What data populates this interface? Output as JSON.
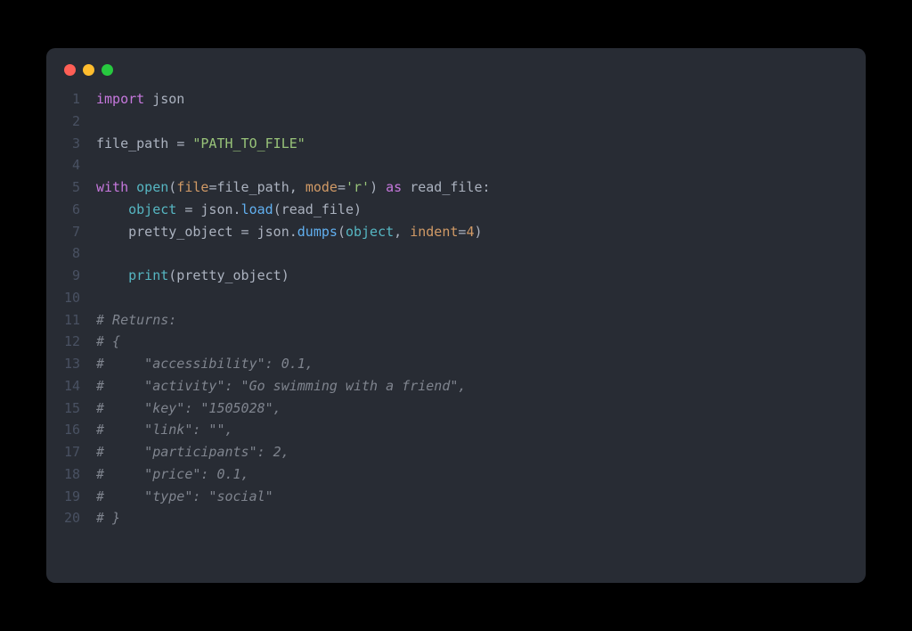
{
  "colors": {
    "background": "#282c34",
    "gutter": "#495162",
    "default": "#abb2bf",
    "keyword": "#c678dd",
    "builtin": "#56b6c2",
    "string": "#98c379",
    "func": "#61afef",
    "param": "#d19a66",
    "number": "#d19a66",
    "comment": "#7f848e",
    "red_dot": "#ff5f56",
    "yellow_dot": "#ffbd2e",
    "green_dot": "#27c93f"
  },
  "lines": [
    {
      "n": "1",
      "tokens": [
        {
          "cls": "keyword",
          "t": "import"
        },
        {
          "cls": "default",
          "t": " "
        },
        {
          "cls": "default",
          "t": "json"
        }
      ]
    },
    {
      "n": "2",
      "tokens": []
    },
    {
      "n": "3",
      "tokens": [
        {
          "cls": "default",
          "t": "file_path "
        },
        {
          "cls": "default",
          "t": "="
        },
        {
          "cls": "default",
          "t": " "
        },
        {
          "cls": "string",
          "t": "\"PATH_TO_FILE\""
        }
      ]
    },
    {
      "n": "4",
      "tokens": []
    },
    {
      "n": "5",
      "tokens": [
        {
          "cls": "keyword",
          "t": "with"
        },
        {
          "cls": "default",
          "t": " "
        },
        {
          "cls": "builtin",
          "t": "open"
        },
        {
          "cls": "default",
          "t": "("
        },
        {
          "cls": "param",
          "t": "file"
        },
        {
          "cls": "default",
          "t": "=file_path, "
        },
        {
          "cls": "param",
          "t": "mode"
        },
        {
          "cls": "default",
          "t": "="
        },
        {
          "cls": "string",
          "t": "'r'"
        },
        {
          "cls": "default",
          "t": ") "
        },
        {
          "cls": "keyword",
          "t": "as"
        },
        {
          "cls": "default",
          "t": " read_file:"
        }
      ]
    },
    {
      "n": "6",
      "tokens": [
        {
          "cls": "default",
          "t": "    "
        },
        {
          "cls": "builtin",
          "t": "object"
        },
        {
          "cls": "default",
          "t": " = json."
        },
        {
          "cls": "func",
          "t": "load"
        },
        {
          "cls": "default",
          "t": "(read_file)"
        }
      ]
    },
    {
      "n": "7",
      "tokens": [
        {
          "cls": "default",
          "t": "    pretty_object = json."
        },
        {
          "cls": "func",
          "t": "dumps"
        },
        {
          "cls": "default",
          "t": "("
        },
        {
          "cls": "builtin",
          "t": "object"
        },
        {
          "cls": "default",
          "t": ", "
        },
        {
          "cls": "param",
          "t": "indent"
        },
        {
          "cls": "default",
          "t": "="
        },
        {
          "cls": "number",
          "t": "4"
        },
        {
          "cls": "default",
          "t": ")"
        }
      ]
    },
    {
      "n": "8",
      "tokens": []
    },
    {
      "n": "9",
      "tokens": [
        {
          "cls": "default",
          "t": "    "
        },
        {
          "cls": "builtin",
          "t": "print"
        },
        {
          "cls": "default",
          "t": "(pretty_object)"
        }
      ]
    },
    {
      "n": "10",
      "tokens": []
    },
    {
      "n": "11",
      "tokens": [
        {
          "cls": "comment",
          "t": "# Returns:"
        }
      ]
    },
    {
      "n": "12",
      "tokens": [
        {
          "cls": "comment",
          "t": "# {"
        }
      ]
    },
    {
      "n": "13",
      "tokens": [
        {
          "cls": "comment",
          "t": "#     \"accessibility\": 0.1,"
        }
      ]
    },
    {
      "n": "14",
      "tokens": [
        {
          "cls": "comment",
          "t": "#     \"activity\": \"Go swimming with a friend\","
        }
      ]
    },
    {
      "n": "15",
      "tokens": [
        {
          "cls": "comment",
          "t": "#     \"key\": \"1505028\","
        }
      ]
    },
    {
      "n": "16",
      "tokens": [
        {
          "cls": "comment",
          "t": "#     \"link\": \"\","
        }
      ]
    },
    {
      "n": "17",
      "tokens": [
        {
          "cls": "comment",
          "t": "#     \"participants\": 2,"
        }
      ]
    },
    {
      "n": "18",
      "tokens": [
        {
          "cls": "comment",
          "t": "#     \"price\": 0.1,"
        }
      ]
    },
    {
      "n": "19",
      "tokens": [
        {
          "cls": "comment",
          "t": "#     \"type\": \"social\""
        }
      ]
    },
    {
      "n": "20",
      "tokens": [
        {
          "cls": "comment",
          "t": "# }"
        }
      ]
    }
  ]
}
